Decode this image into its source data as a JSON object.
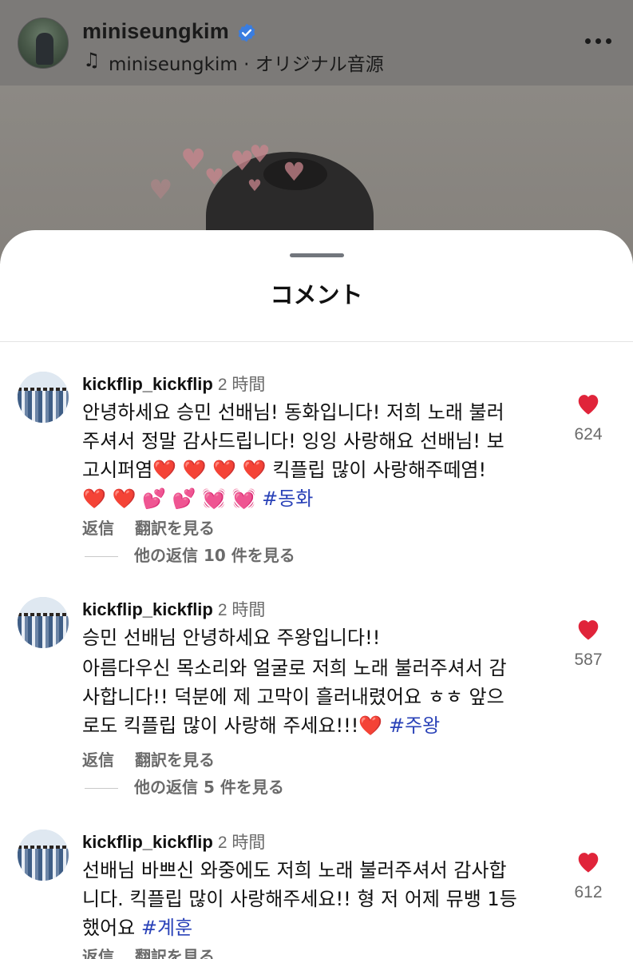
{
  "reel": {
    "username": "miniseungkim",
    "audio": "miniseungkim · オリジナル音源",
    "icons": {
      "verified": "verified-badge-icon",
      "music": "music-note-icon",
      "more": "more-horizontal-icon"
    }
  },
  "sheet": {
    "title": "コメント"
  },
  "comments": [
    {
      "user": "kickflip_kickflip",
      "time": "2 時間",
      "line1": "안녕하세요 승민 선배님! 동화입니다! 저희 노래 불러",
      "line2": "주셔서 정말 감사드립니다! 잉잉 사랑해요 선배님! 보",
      "line3a": "고시퍼염",
      "line3_emoji": "❤️ ❤️ ❤️ ❤️",
      "line3b": " 킥플립 많이 사랑해주떼염!",
      "line4_emoji_red": "❤️ ❤️",
      "line4_emoji_pink": "💕 💕 💓 💓",
      "hashtag": "#동화",
      "reply": "返信",
      "translate": "翻訳を見る",
      "view_replies": "他の返信 10 件を見る",
      "likes": "624"
    },
    {
      "user": "kickflip_kickflip",
      "time": "2 時間",
      "line1": "승민 선배님 안녕하세요 주왕입니다!!",
      "line2": "아름다우신 목소리와 얼굴로 저희 노래 불러주셔서 감",
      "line3": "사합니다!! 덕분에 제 고막이 흘러내렸어요 ㅎㅎ 앞으",
      "line4": "로도 킥플립 많이 사랑해 주세요!!!",
      "line4_emoji": "❤️",
      "hashtag": "#주왕",
      "reply": "返信",
      "translate": "翻訳を見る",
      "view_replies": "他の返信 5 件を見る",
      "likes": "587"
    },
    {
      "user": "kickflip_kickflip",
      "time": "2 時間",
      "line1": "선배님 바쁘신 와중에도 저희 노래 불러주셔서 감사합",
      "line2": "니다. 킥플립 많이 사랑해주세요!! 형 저 어제 뮤뱅 1등",
      "line3": "했어요",
      "hashtag": "#계훈",
      "reply": "返信",
      "translate": "翻訳を見る",
      "likes": "612"
    }
  ],
  "colors": {
    "like_red": "#e0243a",
    "hashtag_blue": "#2a42b8",
    "muted_text": "#6b6b6b"
  }
}
